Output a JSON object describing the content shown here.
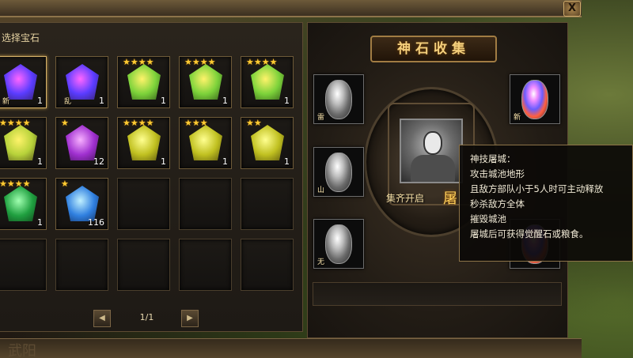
{
  "window": {
    "close_label": "X",
    "bottom_watermark": "武阳"
  },
  "gem_panel": {
    "title": "选择宝石",
    "slots": [
      {
        "gem": "rainbow-crystal-gem",
        "stars": "",
        "count": "1",
        "tag": "新",
        "colors": [
          "#ff66ff",
          "#5a3cff",
          "#2a1a40"
        ]
      },
      {
        "gem": "rainbow-crystal-gem",
        "stars": "",
        "count": "1",
        "tag": "乱",
        "colors": [
          "#ff66ff",
          "#5a3cff",
          "#2a1a40"
        ]
      },
      {
        "gem": "yellow-green-diamond-gem",
        "stars": "★★★★",
        "count": "1",
        "tag": "",
        "colors": [
          "#fff36a",
          "#7cd23a",
          "#1e3a10"
        ]
      },
      {
        "gem": "yellow-green-diamond-gem",
        "stars": "★★★★",
        "count": "1",
        "tag": "",
        "colors": [
          "#fff36a",
          "#7cd23a",
          "#1e3a10"
        ]
      },
      {
        "gem": "yellow-green-diamond-gem",
        "stars": "★★★★",
        "count": "1",
        "tag": "",
        "colors": [
          "#fff36a",
          "#7cd23a",
          "#1e3a10"
        ]
      },
      {
        "gem": "yellow-green-diamond-gem",
        "stars": "★★★★",
        "count": "1",
        "tag": "",
        "colors": [
          "#fff36a",
          "#b7d23a",
          "#3a3010"
        ]
      },
      {
        "gem": "purple-crystal-gem",
        "stars": "★",
        "count": "12",
        "tag": "",
        "colors": [
          "#f7b0ff",
          "#a030d0",
          "#2a0a3a"
        ]
      },
      {
        "gem": "yellow-cluster-gem",
        "stars": "★★★★",
        "count": "1",
        "tag": "",
        "colors": [
          "#ffff90",
          "#c0c020",
          "#3a3208"
        ]
      },
      {
        "gem": "yellow-cluster-gem",
        "stars": "★★★",
        "count": "1",
        "tag": "",
        "colors": [
          "#ffff90",
          "#c0c020",
          "#3a3208"
        ]
      },
      {
        "gem": "yellow-cluster-gem",
        "stars": "★★",
        "count": "1",
        "tag": "",
        "colors": [
          "#ffff90",
          "#c0c020",
          "#3a3208"
        ]
      },
      {
        "gem": "green-emerald-gem",
        "stars": "★★★★",
        "count": "1",
        "tag": "",
        "colors": [
          "#a0ffb0",
          "#20a040",
          "#0a2a10"
        ]
      },
      {
        "gem": "blue-sapphire-gem",
        "stars": "★",
        "count": "116",
        "tag": "",
        "colors": [
          "#c0f0ff",
          "#3080e0",
          "#0a1a40"
        ]
      },
      {
        "gem": "",
        "stars": "",
        "count": "",
        "tag": "",
        "colors": []
      },
      {
        "gem": "",
        "stars": "",
        "count": "",
        "tag": "",
        "colors": []
      },
      {
        "gem": "",
        "stars": "",
        "count": "",
        "tag": "",
        "colors": []
      },
      {
        "gem": "",
        "stars": "",
        "count": "",
        "tag": "",
        "colors": []
      },
      {
        "gem": "",
        "stars": "",
        "count": "",
        "tag": "",
        "colors": []
      },
      {
        "gem": "",
        "stars": "",
        "count": "",
        "tag": "",
        "colors": []
      },
      {
        "gem": "",
        "stars": "",
        "count": "",
        "tag": "",
        "colors": []
      },
      {
        "gem": "",
        "stars": "",
        "count": "",
        "tag": "",
        "colors": []
      }
    ],
    "pager": {
      "prev_label": "◀",
      "page": "1/1",
      "next_label": "▶"
    }
  },
  "collection": {
    "title": "神石收集",
    "unlock_label": "集齐开启",
    "unlock_skill": "屠",
    "left_slots": [
      {
        "tag": "雷"
      },
      {
        "tag": "山"
      },
      {
        "tag": "无"
      }
    ],
    "right_slots": [
      {
        "tag": "新"
      }
    ]
  },
  "tooltip": {
    "lines": [
      "神技屠城：",
      "攻击城池地形",
      "且敌方部队小于5人时可主动释放",
      "秒杀敌方全体",
      "摧毁城池",
      "屠城后可获得觉醒石或粮食。"
    ]
  }
}
